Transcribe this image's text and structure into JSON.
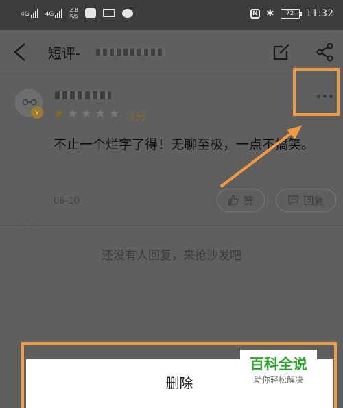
{
  "status_bar": {
    "signal1": "4G",
    "signal2": "4G",
    "speed_value": "2.8",
    "speed_unit": "K/s",
    "battery": "72",
    "time": "11:32"
  },
  "header": {
    "title": "短评-",
    "back_icon": "back-arrow-icon",
    "edit_icon": "edit-icon",
    "share_icon": "share-icon"
  },
  "comment": {
    "rating_stars": 1,
    "rating_max": 5,
    "score": "1分",
    "text": "不止一个烂字了得！无聊至极，一点不搞笑。",
    "date": "06-10",
    "like_label": "赞",
    "reply_label": "回复",
    "more_icon": "more-dots-icon"
  },
  "empty_tip": "还没有人回复，来抢沙发吧",
  "action_sheet": {
    "delete_label": "删除"
  },
  "watermark": {
    "title": "百科全说",
    "subtitle": "助你轻松解决"
  },
  "colors": {
    "highlight": "#f29a3d",
    "rating": "#8a6a1a",
    "watermark_green": "#2aa52a"
  }
}
